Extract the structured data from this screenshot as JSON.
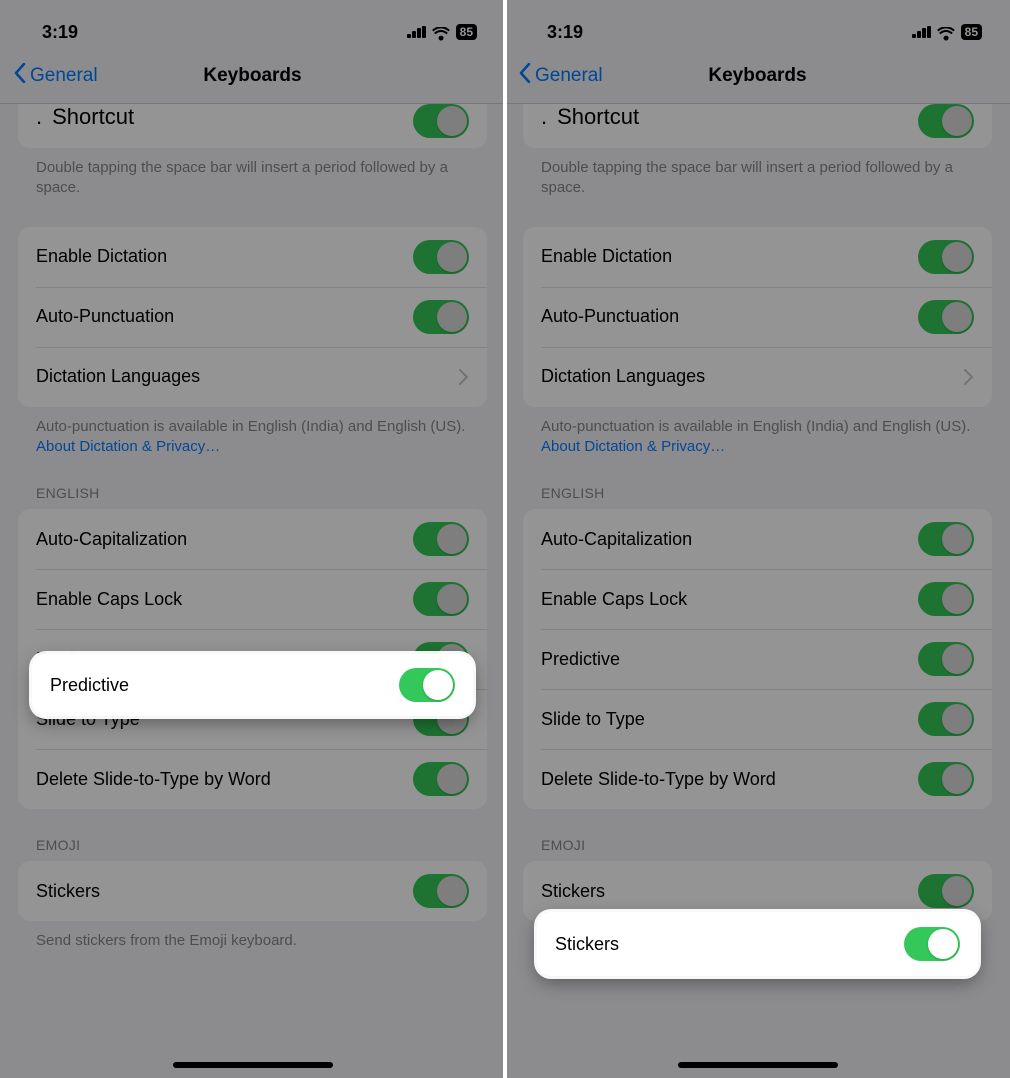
{
  "status": {
    "time": "3:19",
    "battery": "85"
  },
  "nav": {
    "back": "General",
    "title": "Keyboards"
  },
  "rows": {
    "shortcut": "Shortcut",
    "shortcutFooter": "Double tapping the space bar will insert a period followed by a space.",
    "dictation": "Enable Dictation",
    "autoPunct": "Auto-Punctuation",
    "dictLang": "Dictation Languages",
    "dictFooterA": "Auto-punctuation is available in English (India) and English (US). ",
    "dictFooterLink": "About Dictation & Privacy…",
    "englishHeader": "ENGLISH",
    "autoCap": "Auto-Capitalization",
    "capsLock": "Enable Caps Lock",
    "predictive": "Predictive",
    "slide": "Slide to Type",
    "delete": "Delete Slide-to-Type by Word",
    "emojiHeader": "EMOJI",
    "stickers": "Stickers",
    "stickersFooter": "Send stickers from the Emoji keyboard."
  },
  "highlights": {
    "left": {
      "row": "predictive"
    },
    "right": {
      "row": "stickers"
    }
  }
}
